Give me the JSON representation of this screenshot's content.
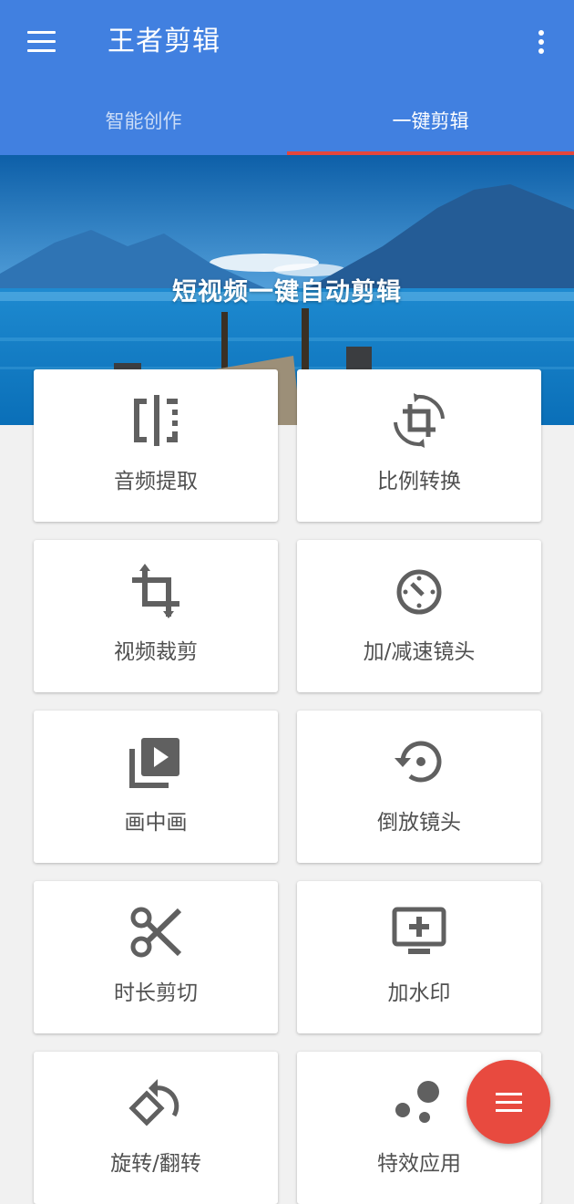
{
  "appbar": {
    "title": "王者剪辑",
    "menu_icon": "hamburger-menu-icon",
    "more_icon": "more-vert-icon",
    "color": "#4180e0"
  },
  "tabs": [
    {
      "label": "智能创作",
      "selected": false
    },
    {
      "label": "一键剪辑",
      "selected": true
    }
  ],
  "tab_indicator_color": "#e4463c",
  "banner": {
    "text": "短视频一键自动剪辑"
  },
  "tools": [
    {
      "label": "音频提取",
      "icon": "audio-extract-icon"
    },
    {
      "label": "比例转换",
      "icon": "aspect-ratio-crop-rotate-icon"
    },
    {
      "label": "视频裁剪",
      "icon": "crop-icon"
    },
    {
      "label": "加/减速镜头",
      "icon": "speed-timer-icon"
    },
    {
      "label": "画中画",
      "icon": "picture-in-picture-play-icon"
    },
    {
      "label": "倒放镜头",
      "icon": "reverse-restore-icon"
    },
    {
      "label": "时长剪切",
      "icon": "scissors-icon"
    },
    {
      "label": "加水印",
      "icon": "add-to-screen-icon"
    },
    {
      "label": "旋转/翻转",
      "icon": "rotate-flip-icon"
    },
    {
      "label": "特效应用",
      "icon": "bubbles-effect-icon"
    }
  ],
  "fab": {
    "icon": "menu-lines-icon",
    "color": "#e84a3f"
  }
}
